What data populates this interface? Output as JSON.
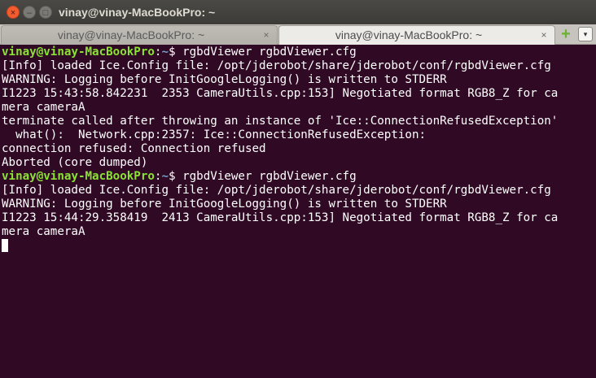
{
  "window": {
    "title": "vinay@vinay-MacBookPro: ~",
    "close_glyph": "×",
    "minimize_glyph": "–",
    "maximize_glyph": "□"
  },
  "tabs": [
    {
      "label": "vinay@vinay-MacBookPro: ~",
      "close_glyph": "×",
      "active": false
    },
    {
      "label": "vinay@vinay-MacBookPro: ~",
      "close_glyph": "×",
      "active": true
    }
  ],
  "tabbar": {
    "add_glyph": "+",
    "menu_glyph": "▾",
    "add_icon": "plus-icon",
    "menu_icon": "chevron-down-icon"
  },
  "terminal": {
    "colors": {
      "background": "#300a24",
      "text": "#ffffff",
      "prompt_user": "#8ae234",
      "prompt_path": "#729fcf"
    },
    "lines": [
      {
        "user": "vinay@vinay-MacBookPro",
        "sep": ":",
        "path": "~",
        "text": "$ rgbdViewer rgbdViewer.cfg"
      },
      {
        "text": "[Info] loaded Ice.Config file: /opt/jderobot/share/jderobot/conf/rgbdViewer.cfg"
      },
      {
        "text": "WARNING: Logging before InitGoogleLogging() is written to STDERR"
      },
      {
        "text": "I1223 15:43:58.842231  2353 CameraUtils.cpp:153] Negotiated format RGB8_Z for ca"
      },
      {
        "text": "mera cameraA"
      },
      {
        "text": "terminate called after throwing an instance of 'Ice::ConnectionRefusedException'"
      },
      {
        "text": "  what():  Network.cpp:2357: Ice::ConnectionRefusedException:"
      },
      {
        "text": "connection refused: Connection refused"
      },
      {
        "text": "Aborted (core dumped)"
      },
      {
        "user": "vinay@vinay-MacBookPro",
        "sep": ":",
        "path": "~",
        "text": "$ rgbdViewer rgbdViewer.cfg"
      },
      {
        "text": "[Info] loaded Ice.Config file: /opt/jderobot/share/jderobot/conf/rgbdViewer.cfg"
      },
      {
        "text": "WARNING: Logging before InitGoogleLogging() is written to STDERR"
      },
      {
        "text": "I1223 15:44:29.358419  2413 CameraUtils.cpp:153] Negotiated format RGB8_Z for ca"
      },
      {
        "text": "mera cameraA"
      }
    ]
  }
}
